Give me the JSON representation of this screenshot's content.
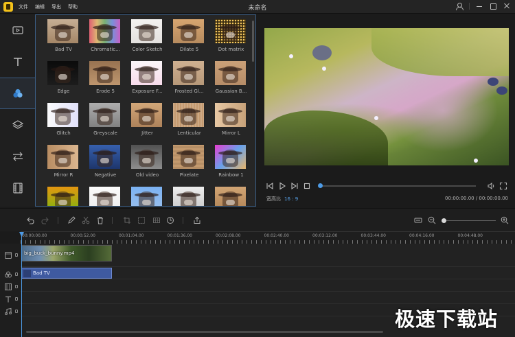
{
  "app": {
    "title": "未命名",
    "menu": [
      "文件",
      "编辑",
      "导出",
      "帮助"
    ]
  },
  "effects": {
    "items": [
      {
        "label": "Bad TV",
        "tint": "#b89a7a",
        "overlay": "linear-gradient(180deg, rgba(255,255,255,0.2), rgba(120,90,60,0.3))"
      },
      {
        "label": "Chromatic...",
        "tint": "#c9a0c0",
        "overlay": "linear-gradient(90deg, rgba(255,0,0,0.4), rgba(255,220,0,0.4), rgba(0,200,0,0.4), rgba(0,120,255,0.4), rgba(200,0,200,0.4))"
      },
      {
        "label": "Color Sketch",
        "tint": "#e8e4e0",
        "overlay": "linear-gradient(180deg, rgba(255,255,255,0.5), rgba(220,220,220,0.4))"
      },
      {
        "label": "Dilate 5",
        "tint": "#c69a6c",
        "overlay": "linear-gradient(180deg, rgba(255,190,120,0.3), rgba(120,80,40,0.2))"
      },
      {
        "label": "Dot matrix",
        "tint": "#d7a84a",
        "overlay": "radial-gradient(circle, rgba(255,210,100,0.9) 1px, rgba(40,30,10,0.9) 1.5px)"
      },
      {
        "label": "Edge",
        "tint": "#1a1a1a",
        "overlay": "linear-gradient(180deg, rgba(0,0,0,0.6), rgba(30,30,30,0.6))"
      },
      {
        "label": "Erode 5",
        "tint": "#b28a62",
        "overlay": "linear-gradient(180deg, rgba(90,60,40,0.3), rgba(220,180,140,0.3))"
      },
      {
        "label": "Exposure F...",
        "tint": "#f3e8ee",
        "overlay": "linear-gradient(180deg, rgba(255,255,255,0.6), rgba(255,200,230,0.4))"
      },
      {
        "label": "Frosted Gl...",
        "tint": "#c2a07c",
        "overlay": "linear-gradient(180deg, rgba(210,180,150,0.8), rgba(180,150,120,0.8))"
      },
      {
        "label": "Gaussian B...",
        "tint": "#c59a72",
        "overlay": "linear-gradient(180deg, rgba(210,170,130,0.4), rgba(150,110,80,0.3))"
      },
      {
        "label": "Glitch",
        "tint": "#f2f2f6",
        "overlay": "linear-gradient(90deg, rgba(255,255,255,0.6), rgba(200,200,255,0.4))"
      },
      {
        "label": "Greyscale",
        "tint": "#9c9c9c",
        "overlay": "linear-gradient(180deg, rgba(200,200,200,0.4), rgba(90,90,90,0.4))"
      },
      {
        "label": "Jitter",
        "tint": "#c5986c",
        "overlay": "linear-gradient(180deg, rgba(240,200,150,0.3), rgba(120,80,50,0.3))"
      },
      {
        "label": "Lenticular",
        "tint": "#c49a70",
        "overlay": "repeating-linear-gradient(90deg, rgba(255,255,255,0.15) 0 2px, transparent 2px 4px)"
      },
      {
        "label": "Mirror L",
        "tint": "#d8b48c",
        "overlay": "linear-gradient(90deg, rgba(255,230,200,0.4), rgba(160,120,80,0.3))"
      },
      {
        "label": "Mirror R",
        "tint": "#c3966a",
        "overlay": "linear-gradient(270deg, rgba(255,230,200,0.4), rgba(160,120,80,0.3))"
      },
      {
        "label": "Negative",
        "tint": "#2d4a86",
        "overlay": "linear-gradient(180deg, rgba(60,110,200,0.6), rgba(20,40,90,0.6))"
      },
      {
        "label": "Old video",
        "tint": "#7a7a7a",
        "overlay": "linear-gradient(180deg, rgba(40,40,40,0.5), rgba(170,170,170,0.4))"
      },
      {
        "label": "Pixelate",
        "tint": "#c49a6e",
        "overlay": "repeating-linear-gradient(0deg, rgba(0,0,0,0.08) 0 3px, transparent 3px 6px)"
      },
      {
        "label": "Rainbow 1",
        "tint": "#d07ad8",
        "overlay": "linear-gradient(135deg, rgba(255,0,200,0.5), rgba(0,200,255,0.5), rgba(255,240,0,0.5))"
      },
      {
        "label": "",
        "tint": "#c8a020",
        "overlay": "linear-gradient(180deg, rgba(255,140,0,0.5), rgba(60,200,0,0.5))"
      },
      {
        "label": "",
        "tint": "#f4f4f4",
        "overlay": "linear-gradient(180deg, rgba(255,255,255,0.6), rgba(230,230,230,0.5))"
      },
      {
        "label": "",
        "tint": "#7faee0",
        "overlay": "linear-gradient(180deg, rgba(120,180,255,0.6), rgba(200,220,255,0.4))"
      },
      {
        "label": "",
        "tint": "#dcdcdc",
        "overlay": "linear-gradient(180deg, rgba(255,255,255,0.5), rgba(180,180,180,0.5))"
      },
      {
        "label": "",
        "tint": "#c99a6a",
        "overlay": "linear-gradient(180deg, rgba(230,190,140,0.3), rgba(120,80,40,0.3))"
      }
    ]
  },
  "preview": {
    "ratio_label": "宽高比",
    "ratio_value": "16 : 9",
    "timecode": "00:00:00.00 / 00:00:00.00",
    "progress": 0
  },
  "timeline": {
    "ruler": [
      "00:00:00.00",
      "00:00:52.00",
      "00:01:04.00",
      "00:01:36.00",
      "00:02:08.00",
      "00:02:40.00",
      "00:03:12.00",
      "00:03:44.00",
      "00:04:16.00",
      "00:04:48.00"
    ],
    "video_clip_name": "big_buck_bunny.mp4",
    "fx_clip_name": "Bad TV",
    "zoom_level": 0.02
  },
  "watermark": "极速下载站",
  "colors": {
    "accent": "#4d9be6",
    "active_border": "#3b5e86",
    "fx_clip": "#3f5aa0"
  }
}
